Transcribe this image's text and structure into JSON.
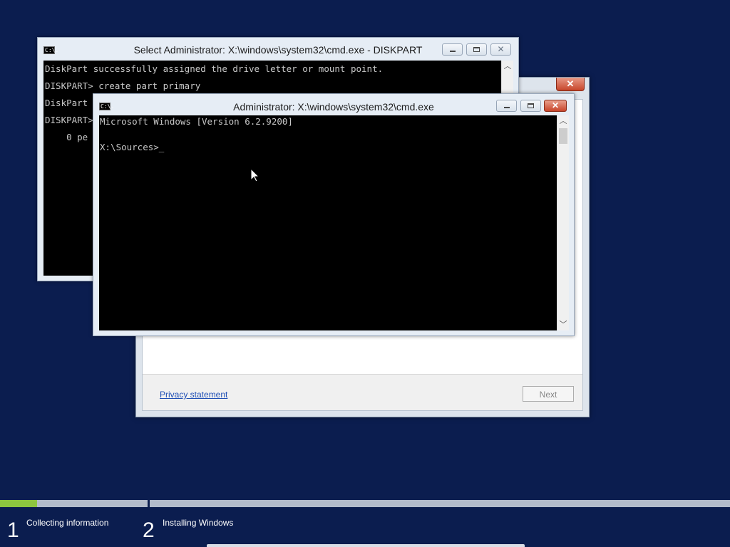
{
  "setup_dialog": {
    "close_glyph": "✕",
    "privacy_link": "Privacy statement",
    "next_button": "Next"
  },
  "back_cmd": {
    "icon_text": "C:\\.",
    "title": "Select Administrator: X:\\windows\\system32\\cmd.exe - DISKPART",
    "lines": [
      "DiskPart successfully assigned the drive letter or mount point.",
      "DISKPART> create part primary",
      "DiskPart",
      "DISKPART>",
      "    0 pe"
    ]
  },
  "front_cmd": {
    "icon_text": "C:\\.",
    "title": "Administrator: X:\\windows\\system32\\cmd.exe",
    "lines": [
      "Microsoft Windows [Version 6.2.9200]",
      "",
      "X:\\Sources>_"
    ]
  },
  "installer_steps": [
    {
      "number": "1",
      "label": "Collecting information",
      "progress": 0.25
    },
    {
      "number": "2",
      "label": "Installing Windows",
      "progress": 0.0
    }
  ],
  "colors": {
    "desktop_bg": "#0b1d4f",
    "progress_fill": "#8dc63f",
    "console_bg": "#000000",
    "console_text": "#c8c8c8"
  }
}
